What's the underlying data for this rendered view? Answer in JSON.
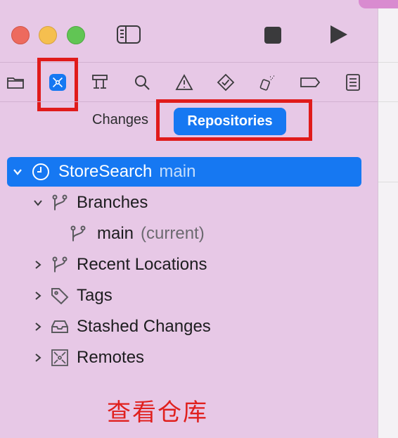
{
  "window": {
    "traffic_lights": [
      "close",
      "minimize",
      "zoom"
    ]
  },
  "toolbar": {
    "sidebar_icon": "sidebar-left-icon",
    "stop_icon": "stop-icon",
    "run_icon": "play-icon"
  },
  "navigator": {
    "icons": [
      "folder-icon",
      "source-control-icon",
      "hierarchy-icon",
      "search-icon",
      "warning-icon",
      "test-diamond-icon",
      "debug-spray-icon",
      "breakpoint-tag-icon",
      "report-list-icon"
    ],
    "active_icon": "source-control-icon"
  },
  "segmented": {
    "changes_label": "Changes",
    "repositories_label": "Repositories"
  },
  "tree": {
    "repo": {
      "name": "StoreSearch",
      "branch": "main"
    },
    "branches_label": "Branches",
    "current_branch": {
      "name": "main",
      "note": "(current)"
    },
    "recent_locations_label": "Recent Locations",
    "tags_label": "Tags",
    "stashed_label": "Stashed Changes",
    "remotes_label": "Remotes"
  },
  "annotation": {
    "caption": "查看仓库",
    "color": "#e0201e"
  },
  "colors": {
    "accent": "#1678f2",
    "sidebar_bg": "#e7c8e6",
    "highlight_box": "#e01b1b"
  }
}
